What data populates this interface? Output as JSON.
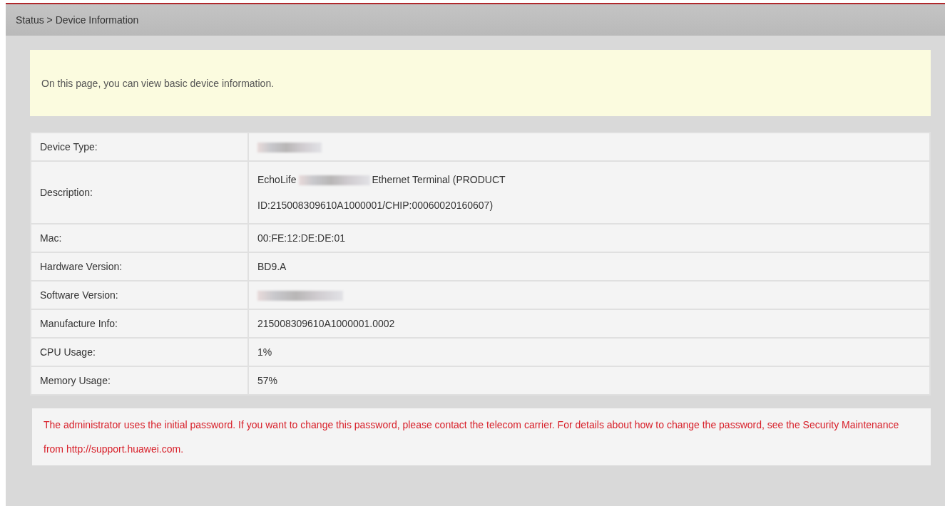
{
  "breadcrumb": "Status > Device Information",
  "notice": "On this page, you can view basic device information.",
  "rows": [
    {
      "label": "Device Type:",
      "parts": [
        {
          "kind": "redacted"
        }
      ]
    },
    {
      "label": "Description:",
      "parts": [
        {
          "kind": "text",
          "text": "EchoLife"
        },
        {
          "kind": "redacted"
        },
        {
          "kind": "text",
          "text": "Ethernet Terminal (PRODUCT"
        },
        {
          "kind": "break"
        },
        {
          "kind": "text",
          "text": "ID:215008309610A1000001/CHIP:00060020160607)"
        }
      ]
    },
    {
      "label": "Mac:",
      "parts": [
        {
          "kind": "text",
          "text": "00:FE:12:DE:DE:01"
        }
      ]
    },
    {
      "label": "Hardware Version:",
      "parts": [
        {
          "kind": "text",
          "text": "BD9.A"
        }
      ]
    },
    {
      "label": "Software Version:",
      "parts": [
        {
          "kind": "redacted"
        }
      ]
    },
    {
      "label": "Manufacture Info:",
      "parts": [
        {
          "kind": "text",
          "text": "215008309610A1000001.0002"
        }
      ]
    },
    {
      "label": "CPU Usage:",
      "parts": [
        {
          "kind": "text",
          "text": "1%"
        }
      ]
    },
    {
      "label": "Memory Usage:",
      "parts": [
        {
          "kind": "text",
          "text": "57%"
        }
      ]
    }
  ],
  "warning": "The administrator uses the initial password. If you want to change this password, please contact the telecom carrier. For details about how to change the password, see the Security Maintenance from http://support.huawei.com."
}
